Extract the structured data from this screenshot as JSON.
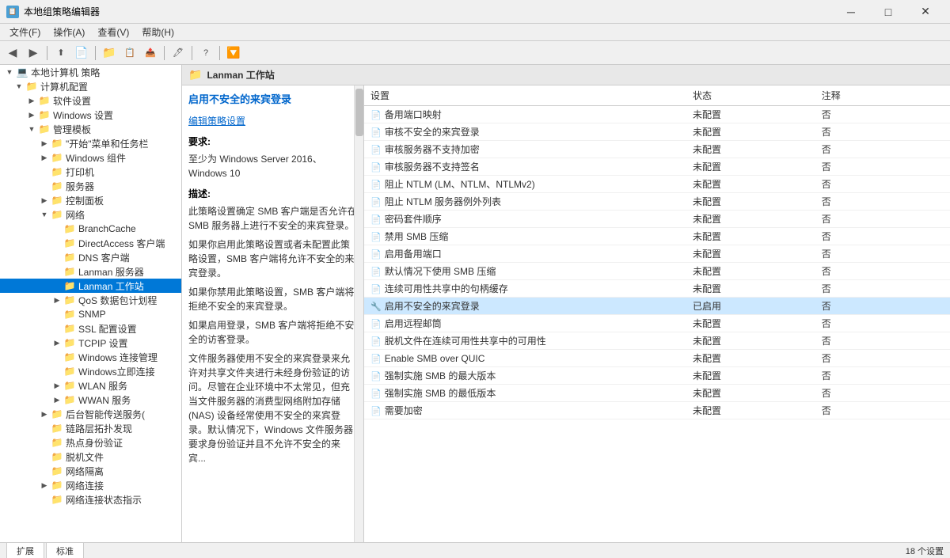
{
  "titleBar": {
    "icon": "📋",
    "title": "本地组策略编辑器",
    "minimizeLabel": "─",
    "maximizeLabel": "□",
    "closeLabel": "✕"
  },
  "menuBar": {
    "items": [
      "文件(F)",
      "操作(A)",
      "查看(V)",
      "帮助(H)"
    ]
  },
  "toolbar": {
    "buttons": [
      "◀",
      "▶",
      "⬆",
      "📄",
      "📁",
      "📋",
      "🔄",
      "🖊",
      "▶",
      "🔽"
    ]
  },
  "tree": {
    "rootLabel": "本地计算机 策略",
    "computerConfig": "计算机配置",
    "softwareSettings": "软件设置",
    "windowsSettings": "Windows 设置",
    "adminTemplates": "管理模板",
    "startMenu": "\"开始\"菜单和任务栏",
    "windowsComponents": "Windows 组件",
    "printer": "打印机",
    "server": "服务器",
    "controlPanel": "控制面板",
    "network": "网络",
    "branchCache": "BranchCache",
    "directAccess": "DirectAccess 客户端",
    "dnsClient": "DNS 客户端",
    "lanmanServer": "Lanman 服务器",
    "lanmanWorkstation": "Lanman 工作站",
    "qos": "QoS 数据包计划程",
    "snmp": "SNMP",
    "ssl": "SSL 配置设置",
    "tcpip": "TCPIP 设置",
    "windowsConnMgr": "Windows 连接管理",
    "windowsInstConn": "Windows立即连接",
    "wlan": "WLAN 服务",
    "wwan": "WWAN 服务",
    "bgIntelligentTransfer": "后台智能传送服务(",
    "linkLayerTopology": "链路层拓扑发现",
    "hotspotAuth": "热点身份验证",
    "offlineFiles": "脱机文件",
    "networkIsolation": "网络隔离",
    "networkConnections": "网络连接",
    "networkConnStatusIndicator": "网络连接状态指示"
  },
  "contentHeader": {
    "icon": "📁",
    "title": "Lanman 工作站"
  },
  "descPanel": {
    "title": "启用不安全的来宾登录",
    "linkText": "编辑策略设置",
    "requireLabel": "要求:",
    "requireText": "至少为 Windows Server 2016、Windows 10",
    "descLabel": "描述:",
    "descText1": "此策略设置确定 SMB 客户端是否允许在 SMB 服务器上进行不安全的来宾登录。",
    "descText2": "如果你启用此策略设置或者未配置此策略设置，SMB 客户端将允许不安全的来宾登录。",
    "descText3": "如果你禁用此策略设置，SMB 客户端将拒绝不安全的来宾登录。",
    "descText4": "如果启用登录，SMB 客户端将拒绝不安全的访客登录。",
    "descText5": "文件服务器使用不安全的来宾登录来允许对共享文件夹进行未经身份验证的访问。尽管在企业环境中不太常见，但充当文件服务器的消费型网络附加存储 (NAS) 设备经常使用不安全的来宾登录。默认情况下，Windows 文件服务器要求身份验证并且不允许不安全的来宾..."
  },
  "settingsTable": {
    "headers": [
      "设置",
      "状态",
      "注释"
    ],
    "rows": [
      {
        "name": "备用端口映射",
        "icon": "doc",
        "status": "未配置",
        "note": "否"
      },
      {
        "name": "审核不安全的来宾登录",
        "icon": "doc",
        "status": "未配置",
        "note": "否"
      },
      {
        "name": "审核服务器不支持加密",
        "icon": "doc",
        "status": "未配置",
        "note": "否"
      },
      {
        "name": "审核服务器不支持签名",
        "icon": "doc",
        "status": "未配置",
        "note": "否"
      },
      {
        "name": "阻止 NTLM (LM、NTLM、NTLMv2)",
        "icon": "doc",
        "status": "未配置",
        "note": "否"
      },
      {
        "name": "阻止 NTLM 服务器例外列表",
        "icon": "doc",
        "status": "未配置",
        "note": "否"
      },
      {
        "name": "密码套件顺序",
        "icon": "doc",
        "status": "未配置",
        "note": "否"
      },
      {
        "name": "禁用 SMB 压缩",
        "icon": "doc",
        "status": "未配置",
        "note": "否"
      },
      {
        "name": "启用备用端口",
        "icon": "doc",
        "status": "未配置",
        "note": "否"
      },
      {
        "name": "默认情况下使用 SMB 压缩",
        "icon": "doc",
        "status": "未配置",
        "note": "否"
      },
      {
        "name": "连续可用性共享中的句柄缓存",
        "icon": "doc",
        "status": "未配置",
        "note": "否"
      },
      {
        "name": "启用不安全的来宾登录",
        "icon": "active",
        "status": "已启用",
        "note": "否",
        "highlighted": true
      },
      {
        "name": "启用远程邮筒",
        "icon": "doc",
        "status": "未配置",
        "note": "否"
      },
      {
        "name": "脱机文件在连续可用性共享中的可用性",
        "icon": "doc",
        "status": "未配置",
        "note": "否"
      },
      {
        "name": "Enable SMB over QUIC",
        "icon": "doc",
        "status": "未配置",
        "note": "否"
      },
      {
        "name": "强制实施 SMB 的最大版本",
        "icon": "doc",
        "status": "未配置",
        "note": "否"
      },
      {
        "name": "强制实施 SMB 的最低版本",
        "icon": "doc",
        "status": "未配置",
        "note": "否"
      },
      {
        "name": "需要加密",
        "icon": "doc",
        "status": "未配置",
        "note": "否"
      }
    ]
  },
  "statusBar": {
    "tabs": [
      "扩展",
      "标准"
    ],
    "settingsCount": "18 个设置"
  }
}
